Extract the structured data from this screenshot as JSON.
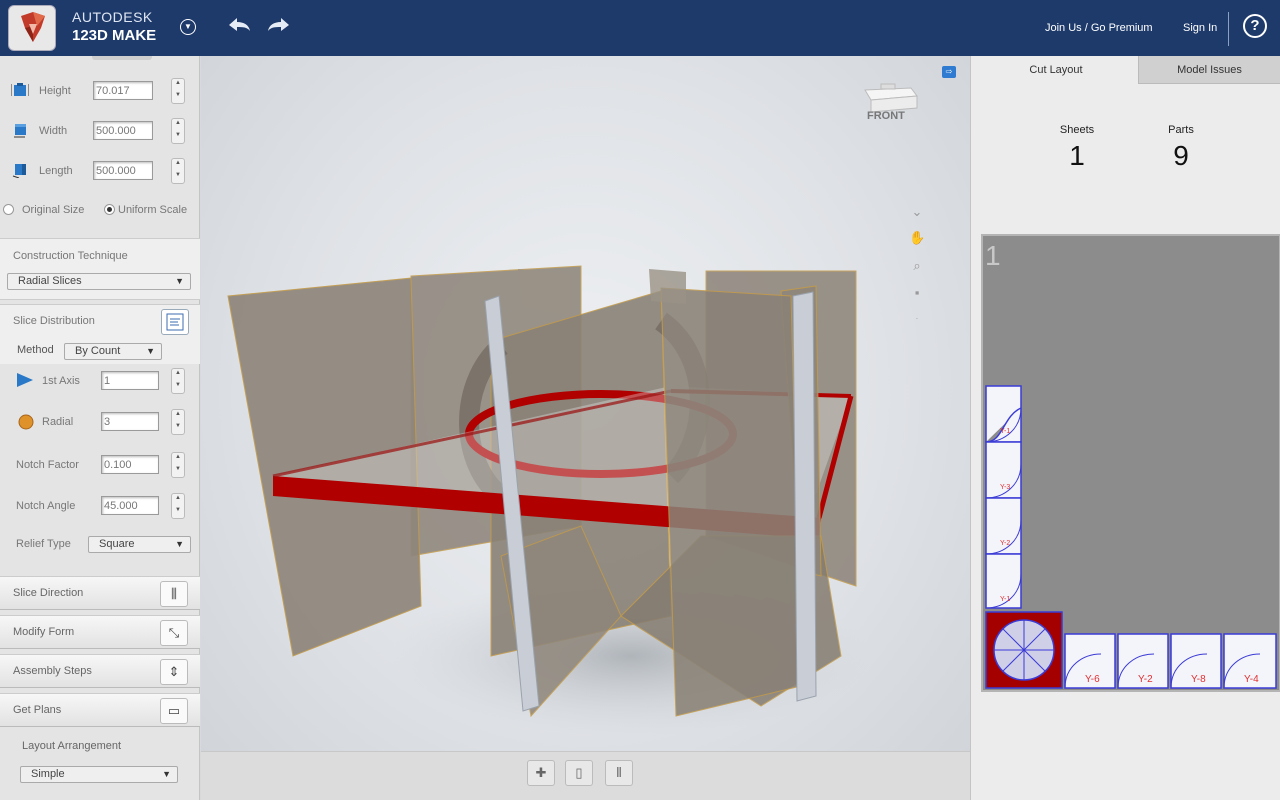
{
  "header": {
    "brand_line1": "AUTODESK",
    "brand_line2": "123D MAKE",
    "join_label": "Join Us / Go Premium",
    "signin_label": "Sign In",
    "help_label": "?"
  },
  "dimensions": {
    "height_label": "Height",
    "height_value": "70.017",
    "width_label": "Width",
    "width_value": "500.000",
    "length_label": "Length",
    "length_value": "500.000",
    "original_size_label": "Original Size",
    "uniform_scale_label": "Uniform Scale"
  },
  "construction": {
    "title": "Construction Technique",
    "value": "Radial Slices"
  },
  "slice_distribution": {
    "title": "Slice Distribution",
    "method_label": "Method",
    "method_value": "By Count",
    "first_axis_label": "1st Axis",
    "first_axis_value": "1",
    "radial_label": "Radial",
    "radial_value": "3",
    "notch_factor_label": "Notch Factor",
    "notch_factor_value": "0.100",
    "notch_angle_label": "Notch Angle",
    "notch_angle_value": "45.000",
    "relief_type_label": "Relief Type",
    "relief_type_value": "Square"
  },
  "accordion": {
    "slice_direction": "Slice Direction",
    "modify_form": "Modify Form",
    "assembly_steps": "Assembly Steps",
    "get_plans": "Get Plans"
  },
  "layout": {
    "label": "Layout Arrangement",
    "value": "Simple"
  },
  "viewport": {
    "viewcube_label": "FRONT"
  },
  "right": {
    "tab_cut_layout": "Cut Layout",
    "tab_model_issues": "Model Issues",
    "sheets_label": "Sheets",
    "sheets_value": "1",
    "parts_label": "Parts",
    "parts_value": "9",
    "sheet_number": "1",
    "parts": [
      "Y-1",
      "Y-3",
      "Y-2",
      "Y-1",
      "Y-6",
      "Y-2",
      "Y-8",
      "Y-4"
    ]
  },
  "colors": {
    "header_bg": "#1e3a6b",
    "part_outline": "#3b3bd6",
    "part_label": "#e03030",
    "slice_red": "#b00000"
  },
  "icons": [
    "logo-icon",
    "dropdown-icon",
    "undo-icon",
    "redo-icon",
    "help-icon",
    "height-icon",
    "width-icon",
    "length-icon",
    "list-icon",
    "axis-icon",
    "radial-icon",
    "slice-direction-icon",
    "modify-form-icon",
    "assembly-icon",
    "plans-icon",
    "pan-icon",
    "zoom-icon",
    "fit-icon",
    "add-icon",
    "battery-icon",
    "bars-icon"
  ]
}
